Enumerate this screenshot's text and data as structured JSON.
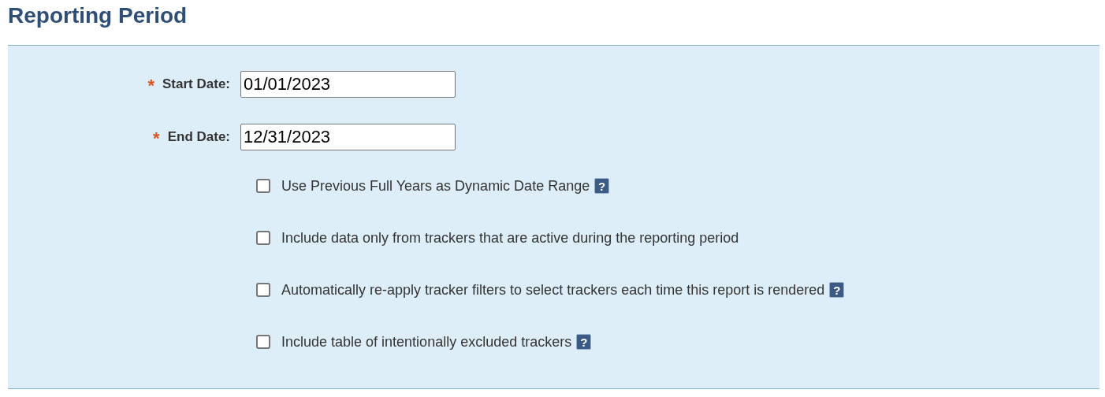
{
  "title": "Reporting Period",
  "fields": [
    {
      "required_mark": "*",
      "label": "Start Date:",
      "value": "01/01/2023"
    },
    {
      "required_mark": "*",
      "label": "End Date:",
      "value": "12/31/2023"
    }
  ],
  "options": [
    {
      "label": "Use Previous Full Years as Dynamic Date Range",
      "checked": false,
      "help": "?"
    },
    {
      "label": "Include data only from trackers that are active during the reporting period",
      "checked": false
    },
    {
      "label": "Automatically re-apply tracker filters to select trackers each time this report is rendered",
      "checked": false,
      "help": "?"
    },
    {
      "label": "Include table of intentionally excluded trackers",
      "checked": false,
      "help": "?"
    }
  ]
}
